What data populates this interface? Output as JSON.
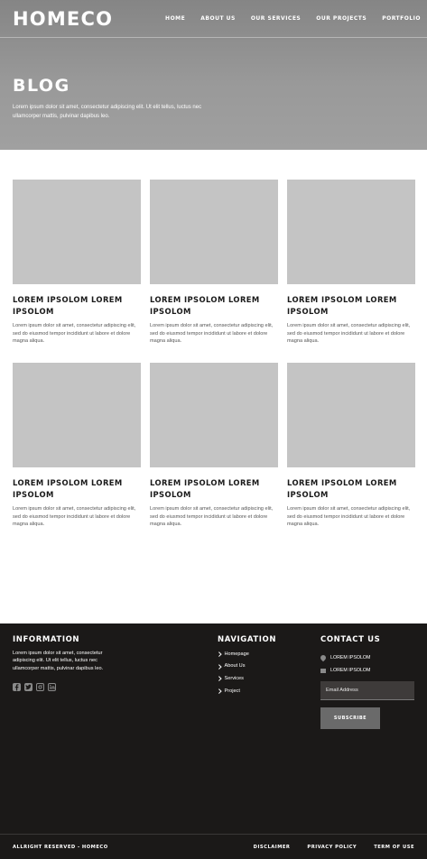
{
  "brand": {
    "logo": "HOMECO"
  },
  "nav": {
    "items": [
      "HOME",
      "ABOUT US",
      "OUR SERVICES",
      "OUR PROJECTS",
      "PORTFOLIO"
    ]
  },
  "hero": {
    "title": "BLOG",
    "text": "Lorem ipsum dolor sit amet, consectetur adipiscing elit. Ut elit tellus, luctus nec ullamcorper mattis, pulvinar dapibus leo."
  },
  "posts": [
    {
      "title": "LOREM IPSOLOM LOREM IPSOLOM",
      "excerpt": "Lorem ipsum dolor sit amet, consectetur adipiscing elit, sed do eiusmod tempor incididunt ut labore et dolore magna aliqua."
    },
    {
      "title": "LOREM IPSOLOM LOREM IPSOLOM",
      "excerpt": "Lorem ipsum dolor sit amet, consectetur adipiscing elit, sed do eiusmod tempor incididunt ut labore et dolore magna aliqua."
    },
    {
      "title": "LOREM IPSOLOM LOREM IPSOLOM",
      "excerpt": "Lorem ipsum dolor sit amet, consectetur adipiscing elit, sed do eiusmod tempor incididunt ut labore et dolore magna aliqua."
    },
    {
      "title": "LOREM IPSOLOM LOREM IPSOLOM",
      "excerpt": "Lorem ipsum dolor sit amet, consectetur adipiscing elit, sed do eiusmod tempor incididunt ut labore et dolore magna aliqua."
    },
    {
      "title": "LOREM IPSOLOM LOREM IPSOLOM",
      "excerpt": "Lorem ipsum dolor sit amet, consectetur adipiscing elit, sed do eiusmod tempor incididunt ut labore et dolore magna aliqua."
    },
    {
      "title": "LOREM IPSOLOM LOREM IPSOLOM",
      "excerpt": "Lorem ipsum dolor sit amet, consectetur adipiscing elit, sed do eiusmod tempor incididunt ut labore et dolore magna aliqua."
    }
  ],
  "footer": {
    "information": {
      "heading": "INFORMATION",
      "text": "Lorem ipsum dolor sit amet, consectetur adipiscing elit. Ut elit tellus, luctus nec ullamcorper mattis, pulvinar dapibus leo.",
      "socials": [
        "facebook-icon",
        "twitter-icon",
        "instagram-icon",
        "linkedin-icon"
      ]
    },
    "navigation": {
      "heading": "NAVIGATION",
      "items": [
        "Homepage",
        "About Us",
        "Services",
        "Project"
      ]
    },
    "contact": {
      "heading": "CONTACT US",
      "address": "LOREM IPSOLOM",
      "email": "LOREM IPSOLOM",
      "email_placeholder": "Email Address",
      "subscribe_label": "SUBSCRIBE"
    },
    "bottom": {
      "copyright": "ALLRIGHT RESERVED - HOMECO",
      "links": [
        "DISCLAIMER",
        "PRIVACY POLICY",
        "TERM OF USE"
      ]
    }
  },
  "colors": {
    "hero_bg": "#999999",
    "placeholder_image": "#c4c4c4",
    "footer_bg": "#1b1918",
    "subscribe_bg": "#6a6a6a"
  }
}
